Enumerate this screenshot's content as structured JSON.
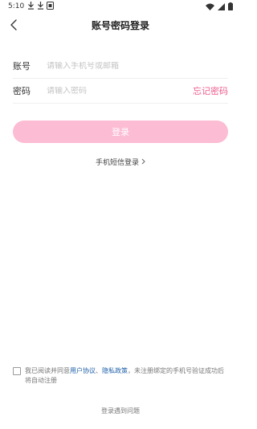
{
  "status_bar": {
    "time": "5:10",
    "left_icons": [
      "download-icon",
      "download-icon",
      "notification-icon"
    ],
    "right_icons": [
      "wifi-icon",
      "signal-icon",
      "battery-icon"
    ]
  },
  "header": {
    "title": "账号密码登录",
    "back_icon": "chevron-left-icon"
  },
  "form": {
    "account_label": "账号",
    "account_placeholder": "请输入手机号或邮箱",
    "account_value": "",
    "password_label": "密码",
    "password_placeholder": "请输入密码",
    "password_value": "",
    "forgot_label": "忘记密码"
  },
  "login_button": {
    "label": "登录"
  },
  "sms_login": {
    "label": "手机短信登录",
    "icon": "chevron-right-icon"
  },
  "agreement": {
    "prefix": "我已阅读并同意",
    "user_agreement": "用户协议",
    "separator": "、",
    "privacy_policy": "隐私政策",
    "suffix": "，未注册绑定的手机号验证成功后将自动注册",
    "checked": false
  },
  "footer": {
    "trouble_label": "登录遇到问题"
  },
  "colors": {
    "accent": "#ee5c8f",
    "button_bg": "#fcbcd3",
    "link": "#1d5fa8"
  }
}
